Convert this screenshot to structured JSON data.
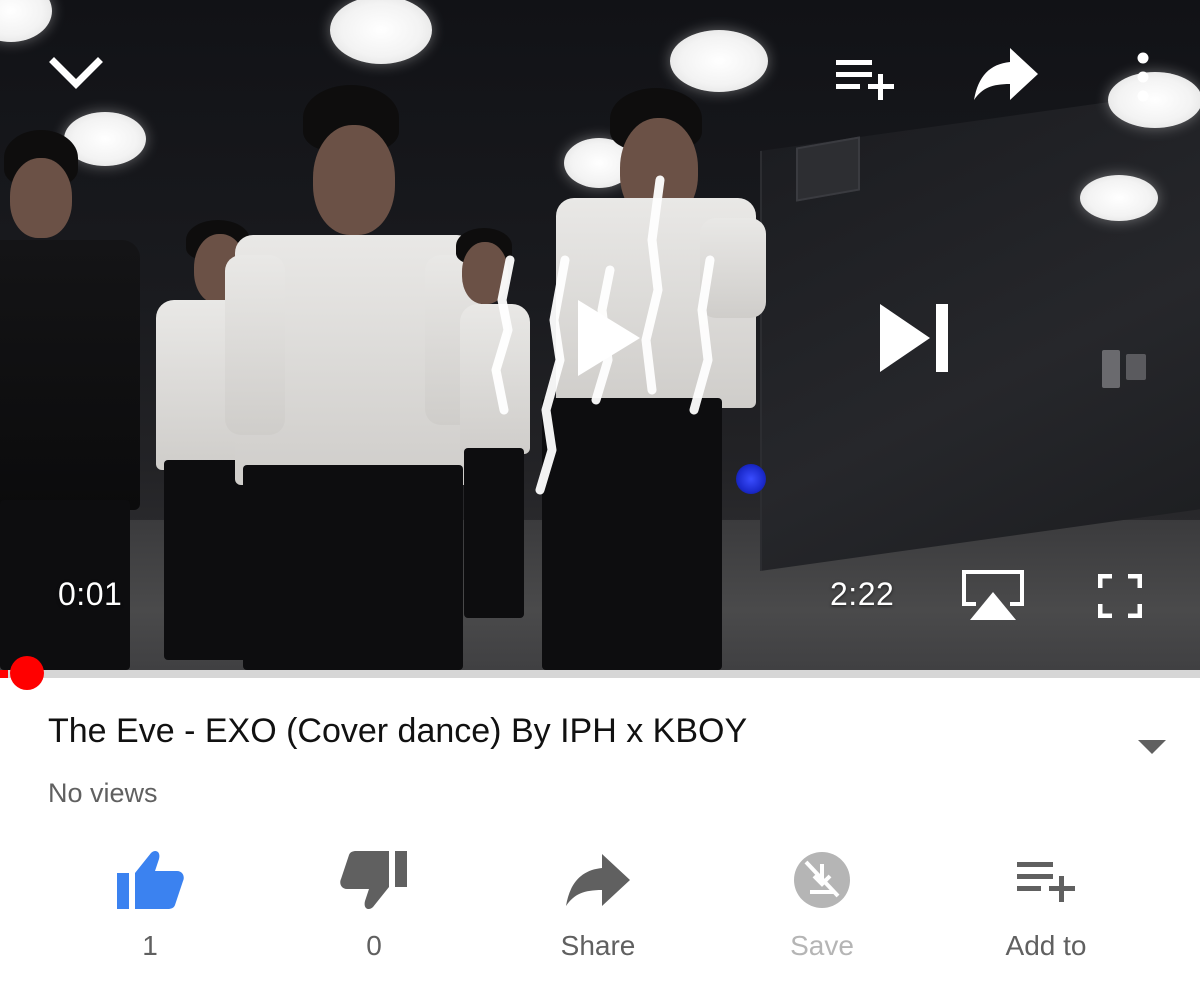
{
  "player": {
    "current_time": "0:01",
    "duration": "2:22",
    "progress_fraction": 0.007,
    "icons": {
      "collapse": "chevron-down-icon",
      "add_to_queue": "playlist-add-icon",
      "share": "share-icon",
      "more": "more-vertical-icon",
      "play": "play-icon",
      "next": "skip-next-icon",
      "airplay": "airplay-icon",
      "fullscreen": "fullscreen-icon"
    },
    "colors": {
      "progress": "#ff0000",
      "track": "#d6d6d6"
    }
  },
  "video": {
    "title": "The Eve - EXO (Cover dance) By IPH x KBOY",
    "views": "No views"
  },
  "actions": [
    {
      "key": "like",
      "label": "1",
      "icon": "thumbs-up-icon",
      "color": "#3b82f0"
    },
    {
      "key": "dislike",
      "label": "0",
      "icon": "thumbs-down-icon",
      "color": "#606060"
    },
    {
      "key": "share",
      "label": "Share",
      "icon": "share-icon",
      "color": "#606060"
    },
    {
      "key": "save",
      "label": "Save",
      "icon": "save-offline-icon",
      "color": "#b5b5b5"
    },
    {
      "key": "add_to",
      "label": "Add to",
      "icon": "playlist-add-icon",
      "color": "#606060"
    }
  ]
}
